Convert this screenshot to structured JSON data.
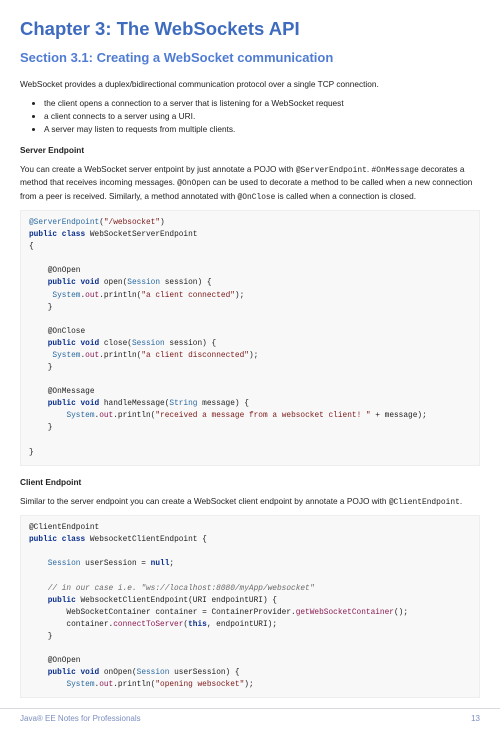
{
  "chapter": {
    "title": "Chapter 3: The WebSockets API"
  },
  "section": {
    "title": "Section 3.1: Creating a WebSocket communication"
  },
  "intro": "WebSocket provides a duplex/bidirectional communication protocol over a single TCP connection.",
  "bullets": [
    "the client opens a connection to a server that is listening for a WebSocket request",
    "a client connects to a server using a URI.",
    "A server may listen to requests from multiple clients."
  ],
  "server": {
    "heading": "Server Endpoint",
    "para_parts": [
      "You can create a WebSocket server entpoint by just annotate a POJO with ",
      "@ServerEndpoint",
      ". ",
      "#OnMessage",
      " decorates a method that receives incoming messages. ",
      "@OnOpen",
      " can be used to decorate a method to be called when a new connection from a peer is received. Similarly, a method annotated with ",
      "@OnClose",
      " is called when a connection is closed."
    ]
  },
  "client": {
    "heading": "Client Endpoint",
    "para_parts": [
      "Similar to the server endpoint you can create a WebSocket client endpoint by annotate a POJO with ",
      "@ClientEndpoint",
      "."
    ]
  },
  "code": {
    "server": {
      "l1a": "@ServerEndpoint",
      "l1b": "(",
      "l1c": "\"/websocket\"",
      "l1d": ")",
      "l2a": "public",
      "l2b": " ",
      "l2c": "class",
      "l2d": " WebSocketServerEndpoint",
      "l3": "{",
      "l5": "    @OnOpen",
      "l6a": "    ",
      "l6b": "public",
      "l6c": " ",
      "l6d": "void",
      "l6e": " open(",
      "l6f": "Session",
      "l6g": " session) {",
      "l7a": "     ",
      "l7b": "System",
      "l7c": ".",
      "l7d": "out",
      "l7e": ".println(",
      "l7f": "\"a client connected\"",
      "l7g": ");",
      "l8": "    }",
      "l10": "    @OnClose",
      "l11a": "    ",
      "l11b": "public",
      "l11c": " ",
      "l11d": "void",
      "l11e": " close(",
      "l11f": "Session",
      "l11g": " session) {",
      "l12a": "     ",
      "l12b": "System",
      "l12c": ".",
      "l12d": "out",
      "l12e": ".println(",
      "l12f": "\"a client disconnected\"",
      "l12g": ");",
      "l13": "    }",
      "l15": "    @OnMessage",
      "l16a": "    ",
      "l16b": "public",
      "l16c": " ",
      "l16d": "void",
      "l16e": " handleMessage(",
      "l16f": "String",
      "l16g": " message) {",
      "l17a": "        ",
      "l17b": "System",
      "l17c": ".",
      "l17d": "out",
      "l17e": ".println(",
      "l17f": "\"received a message from a websocket client! \"",
      "l17g": " + message);",
      "l18": "    }",
      "l20": "}"
    },
    "client": {
      "l1": "@ClientEndpoint",
      "l2a": "public",
      "l2b": " ",
      "l2c": "class",
      "l2d": " WebsocketClientEndpoint {",
      "l4a": "    ",
      "l4b": "Session",
      "l4c": " userSession = ",
      "l4d": "null",
      "l4e": ";",
      "l6a": "    ",
      "l6b": "// in our case i.e. \"ws://localhost:8080/myApp/websocket\"",
      "l7a": "    ",
      "l7b": "public",
      "l7c": " WebsocketClientEndpoint(URI endpointURI) {",
      "l8a": "        WebSocketContainer container = ContainerProvider.",
      "l8b": "getWebSocketContainer",
      "l8c": "();",
      "l9a": "        container.",
      "l9b": "connectToServer",
      "l9c": "(",
      "l9d": "this",
      "l9e": ", endpointURI);",
      "l10": "    }",
      "l12": "    @OnOpen",
      "l13a": "    ",
      "l13b": "public",
      "l13c": " ",
      "l13d": "void",
      "l13e": " onOpen(",
      "l13f": "Session",
      "l13g": " userSession) {",
      "l14a": "        ",
      "l14b": "System",
      "l14c": ".",
      "l14d": "out",
      "l14e": ".println(",
      "l14f": "\"opening websocket\"",
      "l14g": ");"
    }
  },
  "footer": {
    "left": "Java® EE Notes for Professionals",
    "right": "13"
  }
}
